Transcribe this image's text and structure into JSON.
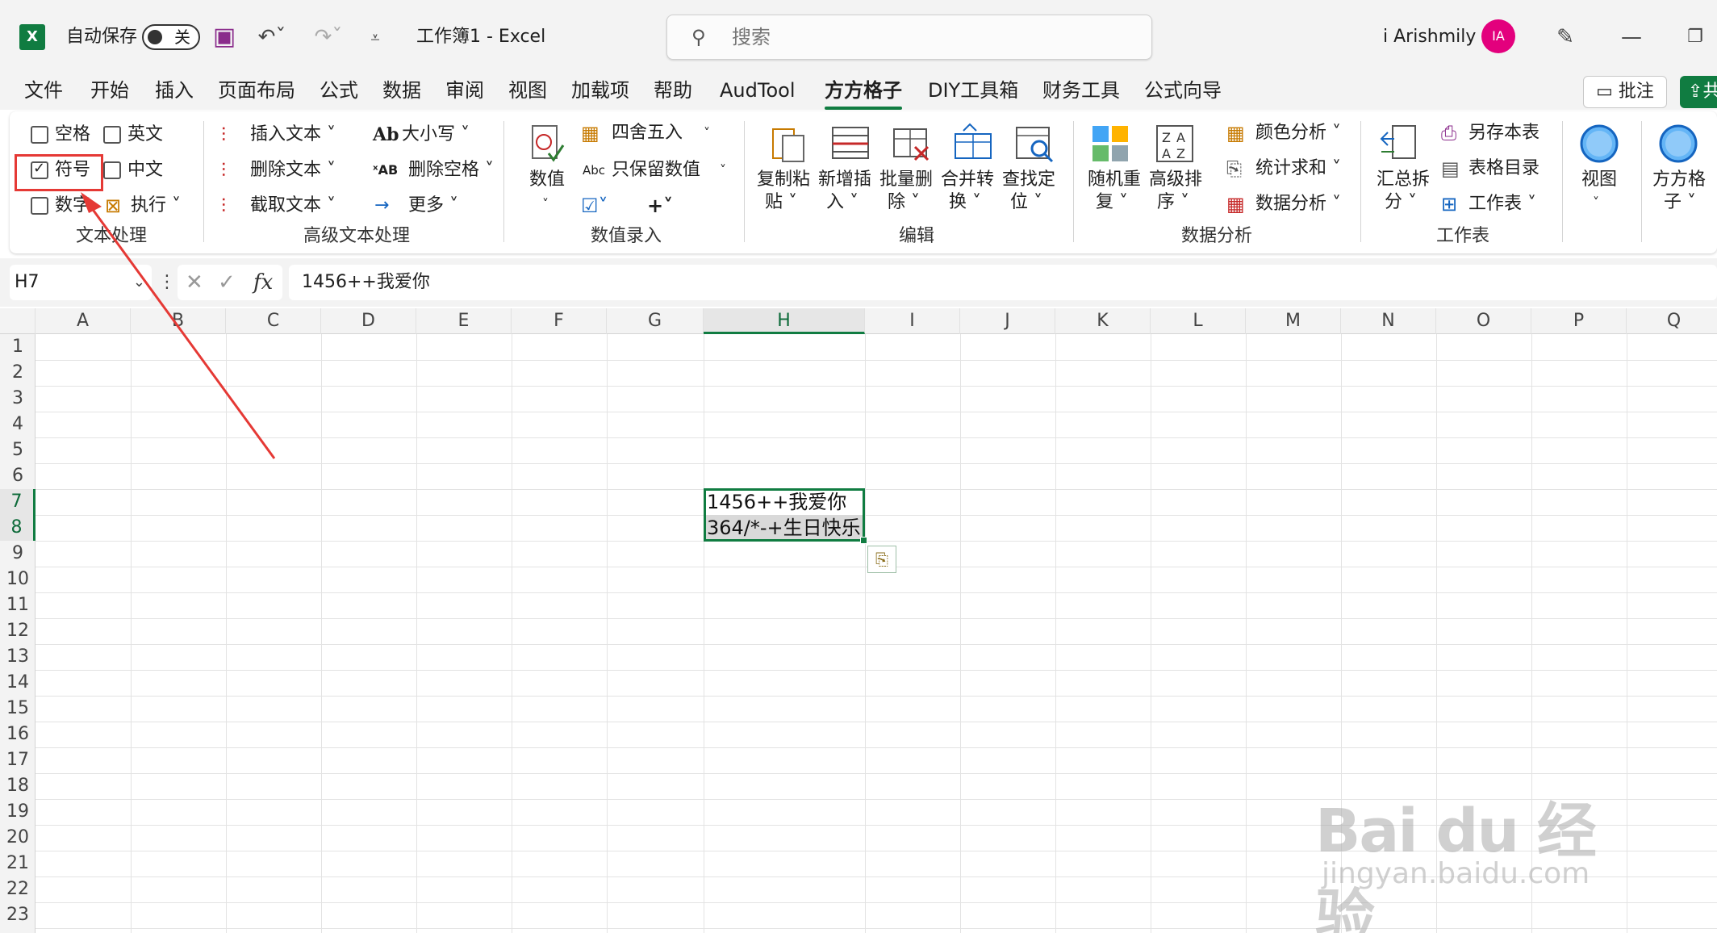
{
  "titlebar": {
    "autosave_label": "自动保存",
    "autosave_state": "关",
    "doc_title": "工作簿1  -  Excel",
    "search_placeholder": "搜索",
    "user_name": "i Arishmily",
    "avatar_initials": "IA"
  },
  "menu": {
    "tabs": [
      "文件",
      "开始",
      "插入",
      "页面布局",
      "公式",
      "数据",
      "审阅",
      "视图",
      "加载项",
      "帮助",
      "AudTool",
      "方方格子",
      "DIY工具箱",
      "财务工具",
      "公式向导"
    ],
    "active_tab": "方方格子",
    "comment_button": "批注",
    "share_button": "共"
  },
  "ribbon": {
    "text_group": {
      "label": "文本处理",
      "space": "空格",
      "english": "英文",
      "symbol": "符号",
      "chinese": "中文",
      "number": "数字",
      "execute": "执行"
    },
    "adv_text_group": {
      "label": "高级文本处理",
      "insert_text": "插入文本",
      "delete_text": "删除文本",
      "extract_text": "截取文本",
      "case": "大小写",
      "delete_space": "删除空格",
      "more": "更多"
    },
    "numeric_group": {
      "label": "数值录入",
      "numeric": "数值",
      "round": "四舍五入",
      "keep_value": "只保留数值"
    },
    "edit_group": {
      "label": "编辑",
      "copy_paste": [
        "复制粘",
        "贴"
      ],
      "new_insert": [
        "新增插",
        "入"
      ],
      "batch_delete": [
        "批量删",
        "除"
      ],
      "merge_convert": [
        "合并转",
        "换"
      ],
      "find_locate": [
        "查找定",
        "位"
      ]
    },
    "analysis_group": {
      "label": "数据分析",
      "random_repeat": [
        "随机重",
        "复"
      ],
      "advanced_sort": [
        "高级排",
        "序"
      ],
      "color_analysis": "颜色分析",
      "stats_sum": "统计求和",
      "data_analysis": "数据分析"
    },
    "sheet_group": {
      "label": "工作表",
      "summary_split": [
        "汇总拆",
        "分"
      ],
      "save_sheet": "另存本表",
      "sheet_index": "表格目录",
      "worksheet": "工作表"
    },
    "view": "视图",
    "ffgz": [
      "方方格",
      "子"
    ]
  },
  "formula_bar": {
    "name_box": "H7",
    "formula": "1456++我爱你"
  },
  "sheet": {
    "columns": [
      "A",
      "B",
      "C",
      "D",
      "E",
      "F",
      "G",
      "H",
      "I",
      "J",
      "K",
      "L",
      "M",
      "N",
      "O",
      "P",
      "Q"
    ],
    "rows": [
      "1",
      "2",
      "3",
      "4",
      "5",
      "6",
      "7",
      "8",
      "9",
      "10",
      "11",
      "12",
      "13",
      "14",
      "15",
      "16",
      "17",
      "18",
      "19",
      "20",
      "21",
      "22",
      "23"
    ],
    "selected_column": "H",
    "selected_rows": [
      "7",
      "8"
    ],
    "cells": {
      "H7": "1456++我爱你",
      "H8": "364/*-+生日快乐"
    }
  },
  "watermark": {
    "brand": "Bai du 经验",
    "url": "jingyan.baidu.com"
  },
  "colors": {
    "excel_green": "#107c41",
    "annotation_red": "#e53935",
    "avatar_pink": "#e3007d"
  }
}
